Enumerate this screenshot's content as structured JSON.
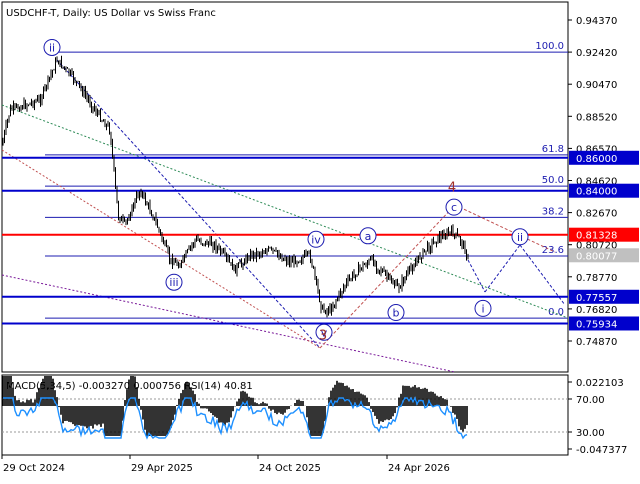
{
  "header": {
    "symbol": "USDCHF-T",
    "timeframe": "Daily",
    "description": "US Dollar vs Swiss Franc",
    "title_text": "USDCHF-T, Daily:  US Dollar vs Swiss Franc"
  },
  "price_axis": {
    "ticks": [
      "0.94370",
      "0.92420",
      "0.90470",
      "0.88520",
      "0.86570",
      "0.84620",
      "0.82670",
      "0.80720",
      "0.78770",
      "0.76820",
      "0.74870"
    ],
    "highlight_labels": [
      {
        "text": "0.86000",
        "price": 0.86,
        "color": "#0000cc"
      },
      {
        "text": "0.84000",
        "price": 0.84,
        "color": "#0000cc"
      },
      {
        "text": "0.81328",
        "price": 0.81328,
        "color": "#ff0000"
      },
      {
        "text": "0.80077",
        "price": 0.80077,
        "color": "#c0c0c0"
      },
      {
        "text": "0.77557",
        "price": 0.77557,
        "color": "#0000cc"
      },
      {
        "text": "0.75934",
        "price": 0.75934,
        "color": "#0000cc"
      }
    ]
  },
  "fibonacci": {
    "levels": [
      {
        "text": "100.0",
        "price": 0.9242
      },
      {
        "text": "61.8",
        "price": 0.8618
      },
      {
        "text": "50.0",
        "price": 0.8428
      },
      {
        "text": "38.2",
        "price": 0.8238
      },
      {
        "text": "23.6",
        "price": 0.8003
      },
      {
        "text": "0.0",
        "price": 0.7626
      }
    ]
  },
  "horizontal_lines": [
    {
      "name": "support-resistance-0.86000",
      "price": 0.86,
      "color": "#0000cc"
    },
    {
      "name": "support-resistance-0.84000",
      "price": 0.84,
      "color": "#0000cc"
    },
    {
      "name": "key-level-0.81328",
      "price": 0.81328,
      "color": "#ff0000"
    },
    {
      "name": "support-resistance-0.77557",
      "price": 0.77557,
      "color": "#0000cc"
    },
    {
      "name": "support-resistance-0.75934",
      "price": 0.75934,
      "color": "#0000cc"
    }
  ],
  "wave_labels": {
    "circled": [
      {
        "text": "ii",
        "price": 0.927
      },
      {
        "text": "iii",
        "price": 0.7844
      },
      {
        "text": "iv",
        "price": 0.8105
      },
      {
        "text": "v",
        "price": 0.754
      },
      {
        "text": "a",
        "price": 0.8126
      },
      {
        "text": "b",
        "price": 0.766
      },
      {
        "text": "c",
        "price": 0.83
      },
      {
        "text": "ii",
        "price": 0.812
      },
      {
        "text": "i",
        "price": 0.7685
      }
    ],
    "plain": [
      {
        "text": "4",
        "price": 0.842
      },
      {
        "text": "3",
        "price": 0.752
      }
    ]
  },
  "indicator": {
    "title_text": "MACD(5,34,5) -0.003270 0.000756 RSI(14) 40.81",
    "macd_name": "MACD(5,34,5)",
    "macd_value": "-0.003270",
    "signal_value": "0.000756",
    "rsi_name": "RSI(14)",
    "rsi_value": "40.81",
    "axis_ticks": [
      "0.022103",
      "70.00",
      "30.00",
      "-0.047377"
    ]
  },
  "time_axis": {
    "labels": [
      "29 Oct 2024",
      "29 Apr 2025",
      "24 Oct 2025",
      "24 Apr 2026"
    ]
  },
  "colors": {
    "candles": "#000000",
    "macd_histogram": "#000000",
    "rsi_line": "#1e90ff",
    "fib_text": "#1c1cb0",
    "wave_label": "#1c1cb0",
    "wave_number": "#a0302a",
    "trend_green": "#2e8b57",
    "trend_purple": "#7a1a9a",
    "trend_red": "#c05050"
  }
}
